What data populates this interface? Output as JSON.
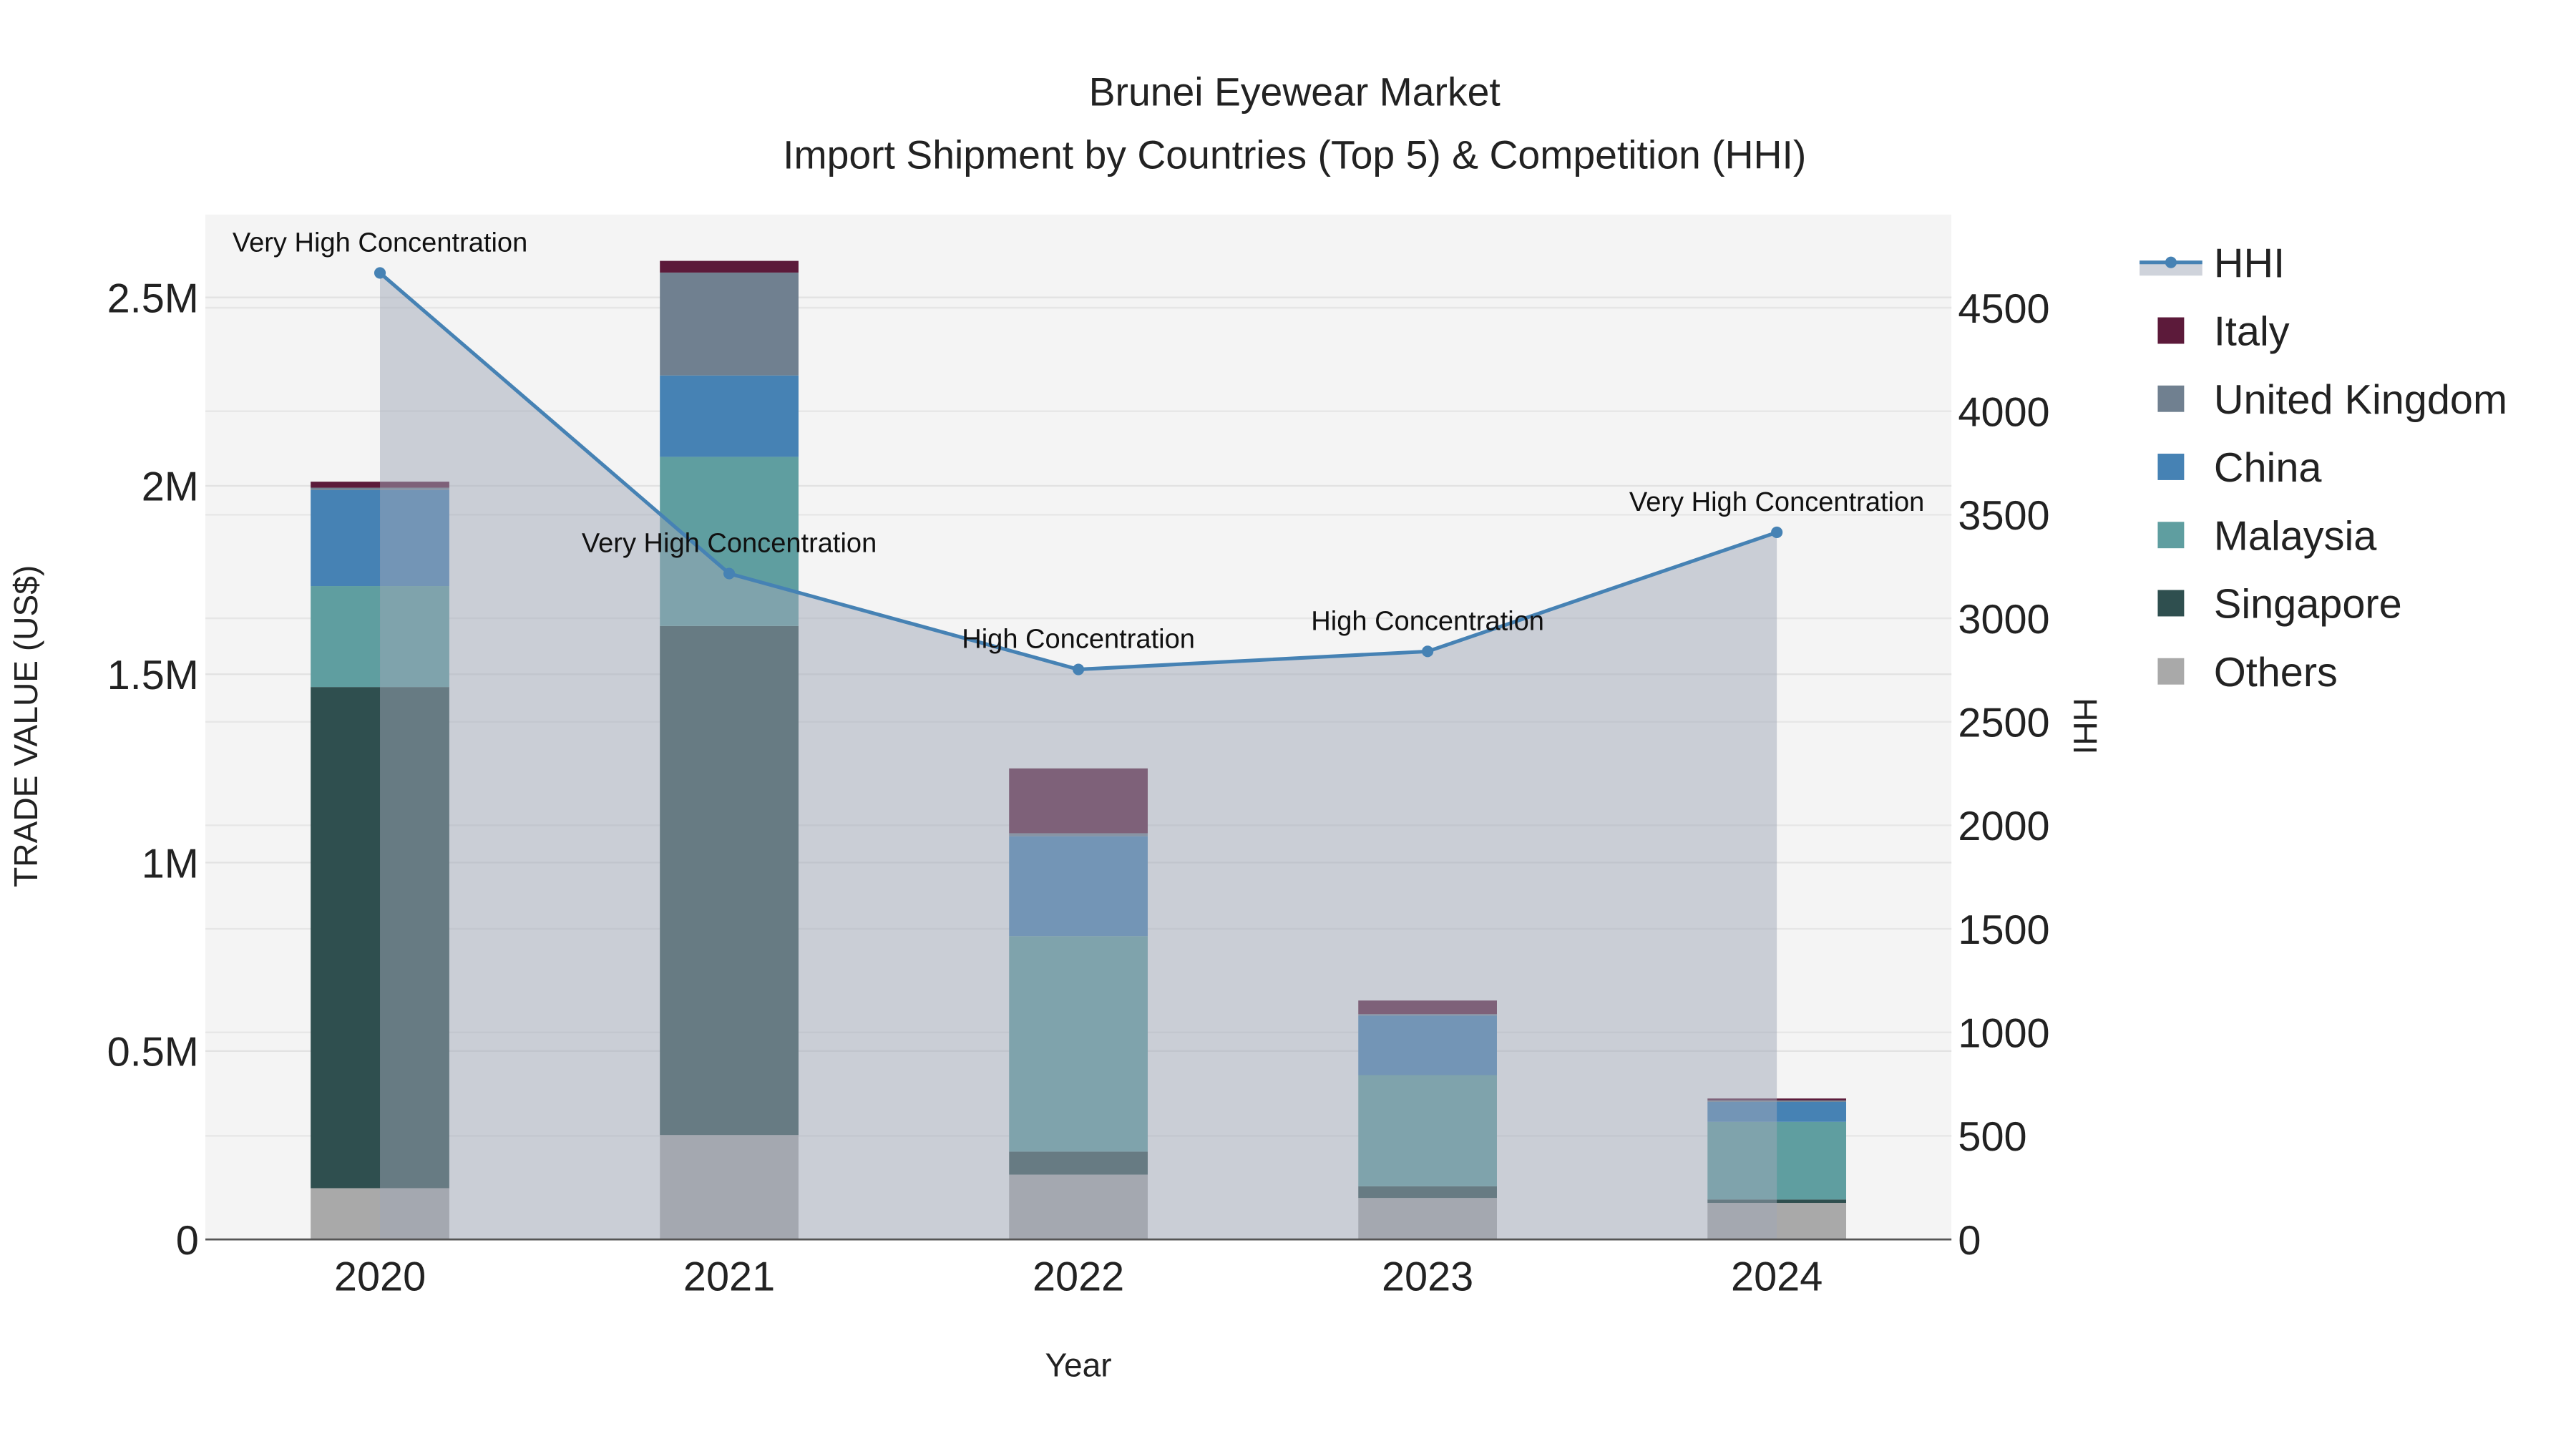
{
  "chart_data": {
    "type": "bar",
    "title": "Brunei Eyewear Market",
    "subtitle": "Import Shipment by Countries (Top 5) & Competition (HHI)",
    "xlabel": "Year",
    "ylabel": "TRADE VALUE (US$)",
    "y2label": "HHI",
    "categories": [
      "2020",
      "2021",
      "2022",
      "2023",
      "2024"
    ],
    "ylim": [
      0,
      2720000
    ],
    "y2lim": [
      0,
      4950
    ],
    "yticks": [
      0,
      500000,
      1000000,
      1500000,
      2000000,
      2500000
    ],
    "ytick_labels": [
      "0",
      "0.5M",
      "1M",
      "1.5M",
      "2M",
      "2.5M"
    ],
    "y2ticks": [
      0,
      500,
      1000,
      1500,
      2000,
      2500,
      3000,
      3500,
      4000,
      4500
    ],
    "y2tick_labels": [
      "0",
      "500",
      "1000",
      "1500",
      "2000",
      "2500",
      "3000",
      "3500",
      "4000",
      "4500"
    ],
    "grid": true,
    "legend_position": "right",
    "series": [
      {
        "name": "Others",
        "color": "#a9a9a9",
        "values": [
          136000,
          277000,
          172000,
          110000,
          97000
        ]
      },
      {
        "name": "Singapore",
        "color": "#2f4f4f",
        "values": [
          1330000,
          1351000,
          61000,
          31000,
          9000
        ]
      },
      {
        "name": "Malaysia",
        "color": "#5f9ea0",
        "values": [
          268000,
          449000,
          572000,
          295000,
          206000
        ]
      },
      {
        "name": "China",
        "color": "#4682b4",
        "values": [
          255000,
          216000,
          265000,
          158000,
          53000
        ]
      },
      {
        "name": "United Kingdom",
        "color": "#708090",
        "values": [
          6000,
          273000,
          8000,
          4000,
          4000
        ]
      },
      {
        "name": "Italy",
        "color": "#5c1a3a",
        "values": [
          16000,
          31000,
          172000,
          36000,
          5000
        ]
      }
    ],
    "hhi": {
      "name": "HHI",
      "color": "#4682b4",
      "values": [
        4668,
        3216,
        2753,
        2840,
        3415
      ],
      "annotations": [
        "Very High Concentration",
        "Very High Concentration",
        "High Concentration",
        "High Concentration",
        "Very High Concentration"
      ]
    },
    "legend_order": [
      "HHI",
      "Italy",
      "United Kingdom",
      "China",
      "Malaysia",
      "Singapore",
      "Others"
    ]
  }
}
